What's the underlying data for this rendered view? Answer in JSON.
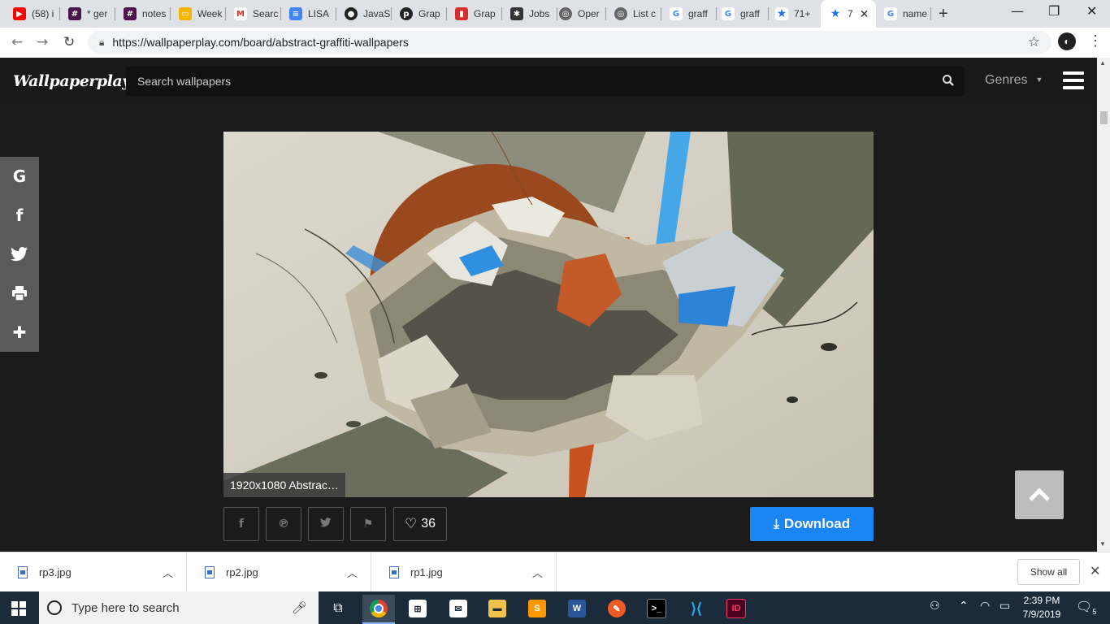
{
  "browser": {
    "tabs": [
      {
        "label": "(58) i",
        "icon": "youtube-icon",
        "color": "#ff0000"
      },
      {
        "label": "* ger",
        "icon": "slack-icon",
        "color": "#4a154b"
      },
      {
        "label": "notes",
        "icon": "slack-icon",
        "color": "#4a154b"
      },
      {
        "label": "Week",
        "icon": "slides-icon",
        "color": "#f4b400"
      },
      {
        "label": "Searc",
        "icon": "gmail-icon",
        "color": "#d93025"
      },
      {
        "label": "LISA",
        "icon": "docs-icon",
        "color": "#4285f4"
      },
      {
        "label": "JavaS",
        "icon": "github-icon",
        "color": "#222222"
      },
      {
        "label": "Grap",
        "icon": "pinterest-icon",
        "color": "#222222"
      },
      {
        "label": "Grap",
        "icon": "bookmark-icon",
        "color": "#d32f2f"
      },
      {
        "label": "Jobs",
        "icon": "jobs-icon",
        "color": "#333333"
      },
      {
        "label": "Oper",
        "icon": "globe-icon",
        "color": "#666666"
      },
      {
        "label": "List c",
        "icon": "globe-icon",
        "color": "#666666"
      },
      {
        "label": "graff",
        "icon": "google-icon",
        "color": "#4285f4"
      },
      {
        "label": "graff",
        "icon": "google-icon",
        "color": "#4285f4"
      },
      {
        "label": "71+ ",
        "icon": "star-icon",
        "color": "#1a73e8"
      },
      {
        "label": "7",
        "icon": "star-icon",
        "color": "#1a73e8"
      },
      {
        "label": "name",
        "icon": "google-icon",
        "color": "#4285f4"
      }
    ],
    "url": "https://wallpaperplay.com/board/abstract-graffiti-wallpapers"
  },
  "site": {
    "logo": "Wallpaperplay",
    "search_placeholder": "Search wallpapers",
    "genres_label": "Genres"
  },
  "share_bar": [
    {
      "icon": "google-icon",
      "glyph": "G"
    },
    {
      "icon": "facebook-icon",
      "glyph": "f"
    },
    {
      "icon": "twitter-icon",
      "glyph": "t"
    },
    {
      "icon": "print-icon",
      "glyph": "p"
    },
    {
      "icon": "plus-icon",
      "glyph": "+"
    }
  ],
  "wallpaper": {
    "caption": "1920x1080 Abstrac…",
    "like_count": "36",
    "download_label": "Download"
  },
  "downloads": [
    {
      "name": "rp3.jpg"
    },
    {
      "name": "rp2.jpg"
    },
    {
      "name": "rp1.jpg"
    }
  ],
  "downloads_show_all": "Show all",
  "taskbar": {
    "search_placeholder": "Type here to search",
    "time": "2:39 PM",
    "date": "7/9/2019",
    "notification_count": "5"
  },
  "colors": {
    "download_button": "#1a86f5",
    "site_header": "#191919"
  }
}
